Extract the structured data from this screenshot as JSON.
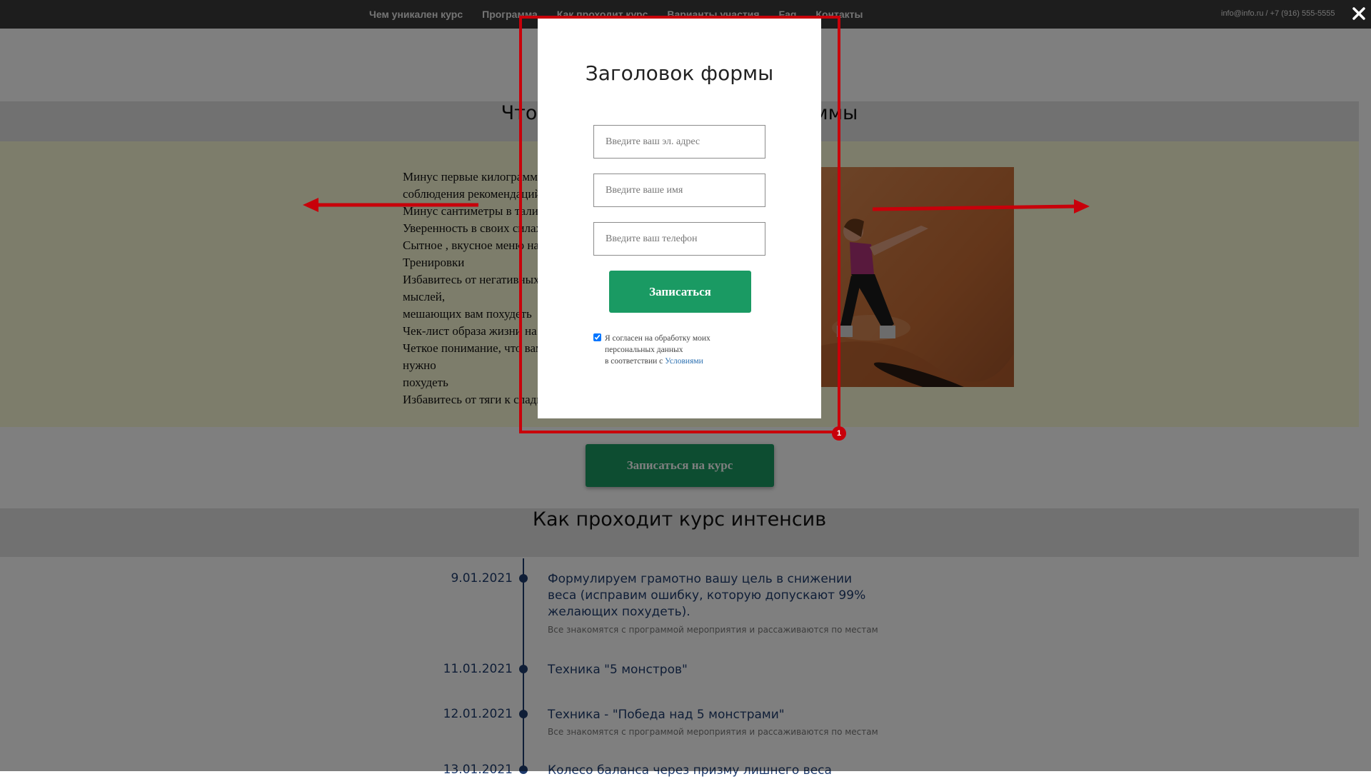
{
  "nav": {
    "items": [
      {
        "label": "Чем уникален курс"
      },
      {
        "label": "Программа"
      },
      {
        "label": "Как проходит курс"
      },
      {
        "label": "Варианты участия"
      },
      {
        "label": "Faq"
      },
      {
        "label": "Контакты"
      }
    ],
    "contact": "info@info.ru / +7 (916) 555-5555",
    "close_icon": "close-icon"
  },
  "benefits": {
    "title": "Что вы получите после программы",
    "items": [
      "Минус первые килограммы при",
      "соблюдения рекомендаций",
      "Минус сантиметры в талии",
      "Уверенность в своих силах",
      "Сытное , вкусное меню на",
      "Тренировки",
      "Избавитесь от негативных мыслей,",
      "мешающих вам похудеть",
      "Чек-лист образа жизни на",
      "Четкое понимание, что вам нужно",
      "похудеть",
      "Избавитесь от тяги к сладкому"
    ]
  },
  "cta": {
    "label": "Записаться на курс"
  },
  "course": {
    "title": "Как проходит курс интенсив",
    "timeline": [
      {
        "date": "9.01.2021",
        "title": "Формулируем грамотно вашу цель в снижении веса (исправим ошибку, которую допускают 99% желающих похудеть).",
        "desc": "Все знакомятся с программой мероприятия и рассаживаются по местам"
      },
      {
        "date": "11.01.2021",
        "title": "Техника \"5 монстров\"",
        "desc": ""
      },
      {
        "date": "12.01.2021",
        "title": "Техника - \"Победа над 5 монстрами\"",
        "desc": "Все знакомятся с программой мероприятия и рассаживаются по местам"
      },
      {
        "date": "13.01.2021",
        "title": "Колесо баланса через призму лишнего веса",
        "desc": ""
      }
    ]
  },
  "modal": {
    "title": "Заголовок формы",
    "email_placeholder": "Введите ваш эл. адрес",
    "name_placeholder": "Введите ваше имя",
    "phone_placeholder": "Введите ваш телефон",
    "submit_label": "Записаться",
    "consent_checked": true,
    "consent_line1": "Я согласен на обработку моих",
    "consent_line2": "персональных данных",
    "consent_line3": "в соответствии с ",
    "consent_link": "Условиями"
  },
  "annotation": {
    "badge": "1"
  },
  "colors": {
    "accent": "#1a9a63",
    "navy": "#1f3c6e",
    "annotation": "#c8000a"
  }
}
